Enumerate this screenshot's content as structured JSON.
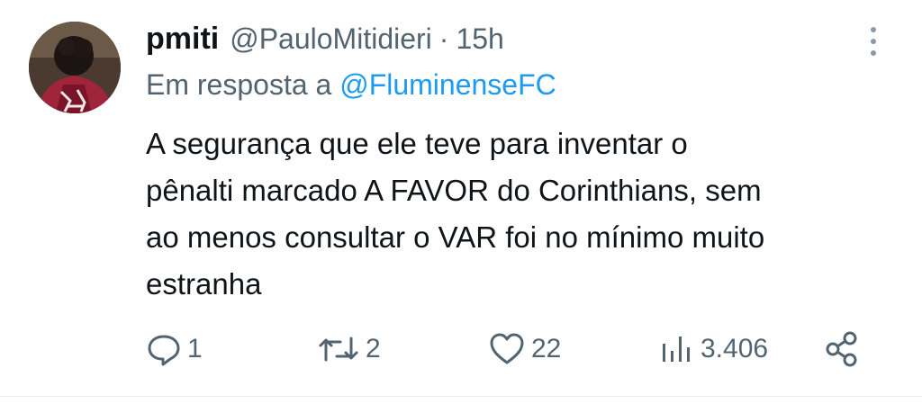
{
  "tweet": {
    "display_name": "pmiti",
    "handle": "@PauloMitidieri",
    "separator": "·",
    "time": "15h",
    "reply_prefix": "Em resposta a",
    "reply_handle": "@FluminenseFC",
    "text": "A segurança que ele teve para inventar o\npênalti marcado A FAVOR do Corinthians, sem\nao menos consultar o VAR foi no mínimo muito\nestranha",
    "actions": {
      "reply_count": "1",
      "retweet_count": "2",
      "like_count": "22",
      "views_count": "3.406"
    }
  },
  "colors": {
    "text_primary": "#0f1419",
    "text_secondary": "#536471",
    "link": "#1d9bf0",
    "divider": "#e7eaed"
  },
  "icons": {
    "reply": "speech-bubble-icon",
    "retweet": "retweet-arrows-icon",
    "like": "heart-icon",
    "views": "bar-chart-icon",
    "share": "share-nodes-icon",
    "more": "vertical-dots-icon"
  }
}
